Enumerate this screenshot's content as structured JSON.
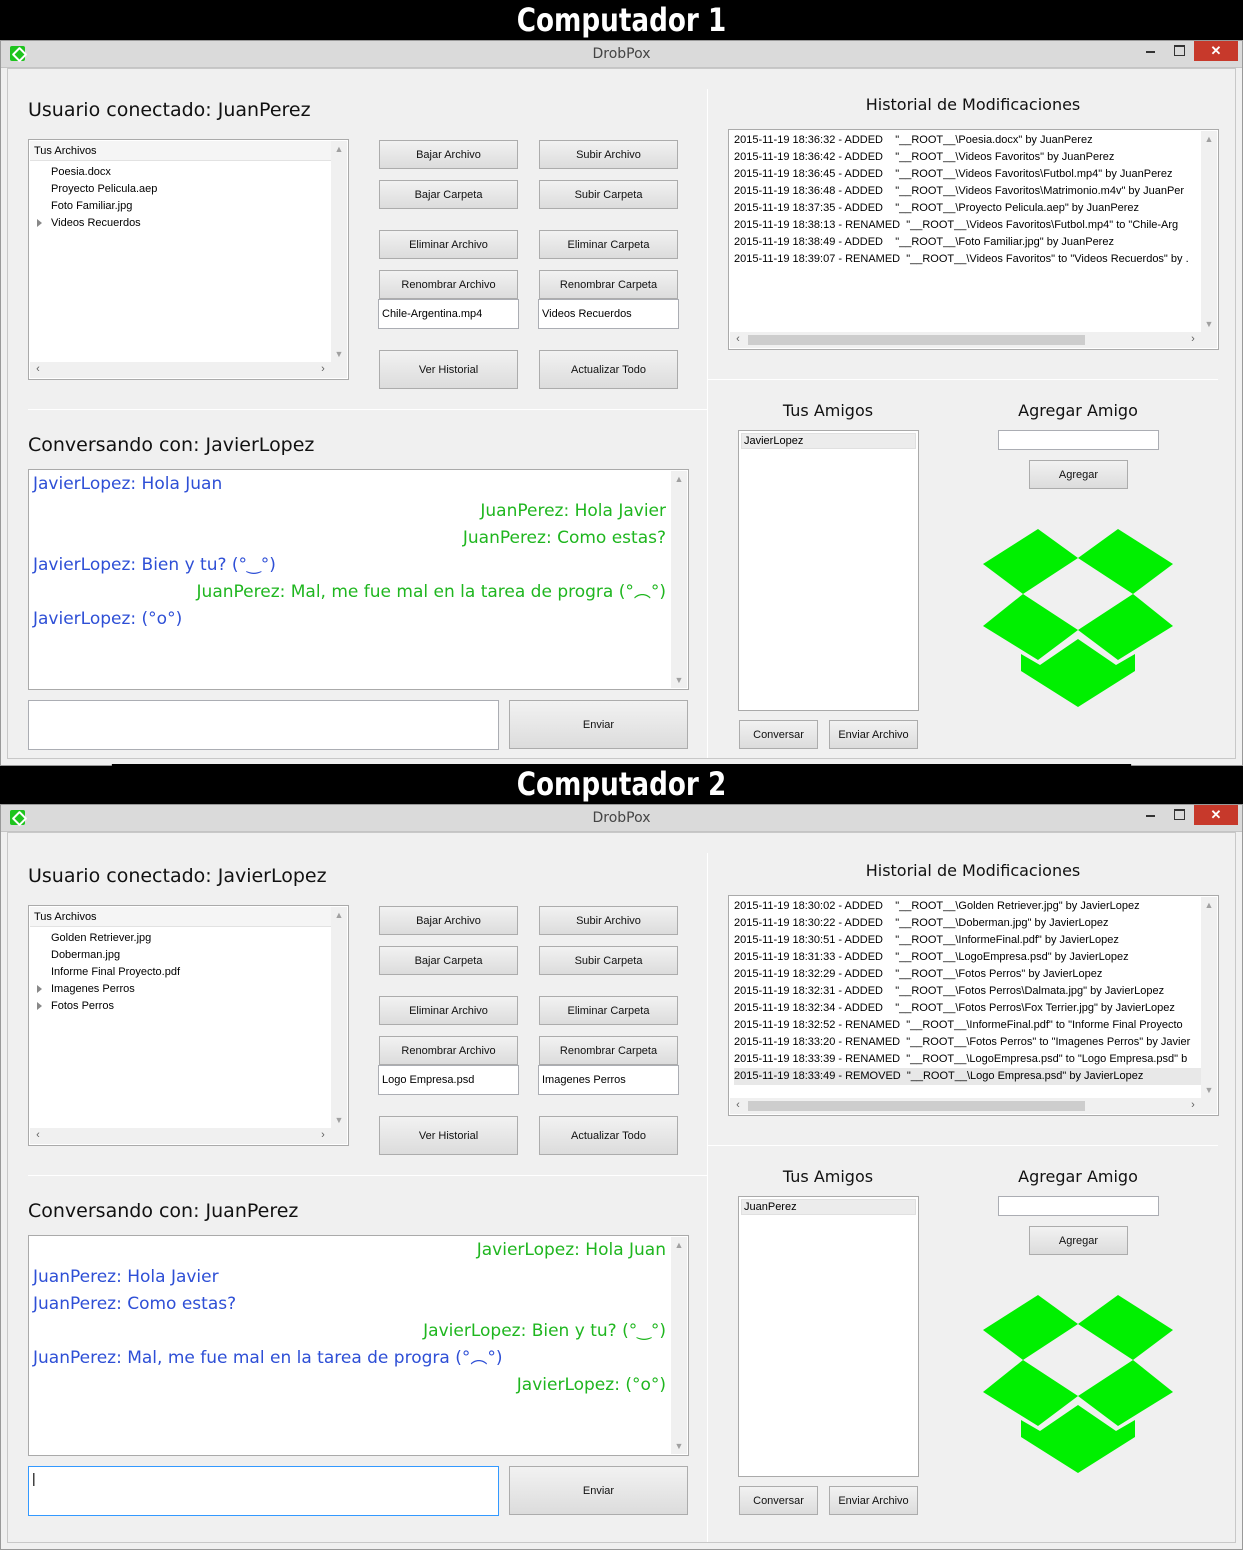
{
  "computers": [
    {
      "banner": "Computador 1",
      "window_title": "DrobPox",
      "user_label": "Usuario conectado: JuanPerez",
      "files_tree": {
        "header": "Tus Archivos",
        "items": [
          {
            "label": "Poesia.docx",
            "expandable": false
          },
          {
            "label": "Proyecto Pelicula.aep",
            "expandable": false
          },
          {
            "label": "Foto Familiar.jpg",
            "expandable": false
          },
          {
            "label": "Videos Recuerdos",
            "expandable": true
          }
        ]
      },
      "buttons": {
        "download_file": "Bajar Archivo",
        "upload_file": "Subir Archivo",
        "download_folder": "Bajar Carpeta",
        "upload_folder": "Subir Carpeta",
        "delete_file": "Eliminar Archivo",
        "delete_folder": "Eliminar Carpeta",
        "rename_file": "Renombrar Archivo",
        "rename_folder": "Renombrar Carpeta",
        "view_history": "Ver Historial",
        "refresh_all": "Actualizar Todo",
        "send": "Enviar",
        "add": "Agregar",
        "chat": "Conversar",
        "send_file": "Enviar Archivo"
      },
      "rename_file_value": "Chile-Argentina.mp4",
      "rename_folder_value": "Videos Recuerdos",
      "history_title": "Historial de Modificaciones",
      "history": [
        "2015-11-19 18:36:32 - ADDED    \"__ROOT__\\Poesia.docx\" by JuanPerez",
        "2015-11-19 18:36:42 - ADDED    \"__ROOT__\\Videos Favoritos\" by JuanPerez",
        "2015-11-19 18:36:45 - ADDED    \"__ROOT__\\Videos Favoritos\\Futbol.mp4\" by JuanPerez",
        "2015-11-19 18:36:48 - ADDED    \"__ROOT__\\Videos Favoritos\\Matrimonio.m4v\" by JuanPer",
        "2015-11-19 18:37:35 - ADDED    \"__ROOT__\\Proyecto Pelicula.aep\" by JuanPerez",
        "2015-11-19 18:38:13 - RENAMED  \"__ROOT__\\Videos Favoritos\\Futbol.mp4\" to \"Chile-Arg",
        "2015-11-19 18:38:49 - ADDED    \"__ROOT__\\Foto Familiar.jpg\" by JuanPerez",
        "2015-11-19 18:39:07 - RENAMED  \"__ROOT__\\Videos Favoritos\" to \"Videos Recuerdos\" by ."
      ],
      "history_selected_index": -1,
      "chat_label": "Conversando con: JavierLopez",
      "messages": [
        {
          "side": "left",
          "text": "JavierLopez: Hola Juan"
        },
        {
          "side": "right",
          "text": "JuanPerez: Hola Javier"
        },
        {
          "side": "right",
          "text": "JuanPerez: Como estas?"
        },
        {
          "side": "left",
          "text": "JavierLopez: Bien y tu? (°‿°)"
        },
        {
          "side": "right",
          "text": "JuanPerez: Mal, me fue mal en la tarea de progra (°︵°)"
        },
        {
          "side": "left",
          "text": "JavierLopez: (°o°)"
        }
      ],
      "message_input": "",
      "friends_title": "Tus Amigos",
      "friends": [
        "JavierLopez"
      ],
      "add_friend_title": "Agregar Amigo",
      "add_friend_input": ""
    },
    {
      "banner": "Computador 2",
      "window_title": "DrobPox",
      "user_label": "Usuario conectado: JavierLopez",
      "files_tree": {
        "header": "Tus Archivos",
        "items": [
          {
            "label": "Golden Retriever.jpg",
            "expandable": false
          },
          {
            "label": "Doberman.jpg",
            "expandable": false
          },
          {
            "label": "Informe Final Proyecto.pdf",
            "expandable": false
          },
          {
            "label": "Imagenes Perros",
            "expandable": true
          },
          {
            "label": "Fotos Perros",
            "expandable": true
          }
        ]
      },
      "buttons": {
        "download_file": "Bajar Archivo",
        "upload_file": "Subir Archivo",
        "download_folder": "Bajar Carpeta",
        "upload_folder": "Subir Carpeta",
        "delete_file": "Eliminar Archivo",
        "delete_folder": "Eliminar Carpeta",
        "rename_file": "Renombrar Archivo",
        "rename_folder": "Renombrar Carpeta",
        "view_history": "Ver Historial",
        "refresh_all": "Actualizar Todo",
        "send": "Enviar",
        "add": "Agregar",
        "chat": "Conversar",
        "send_file": "Enviar Archivo"
      },
      "rename_file_value": "Logo Empresa.psd",
      "rename_folder_value": "Imagenes Perros",
      "history_title": "Historial de Modificaciones",
      "history": [
        "2015-11-19 18:30:02 - ADDED    \"__ROOT__\\Golden Retriever.jpg\" by JavierLopez",
        "2015-11-19 18:30:22 - ADDED    \"__ROOT__\\Doberman.jpg\" by JavierLopez",
        "2015-11-19 18:30:51 - ADDED    \"__ROOT__\\InformeFinal.pdf\" by JavierLopez",
        "2015-11-19 18:31:33 - ADDED    \"__ROOT__\\LogoEmpresa.psd\" by JavierLopez",
        "2015-11-19 18:32:29 - ADDED    \"__ROOT__\\Fotos Perros\" by JavierLopez",
        "2015-11-19 18:32:31 - ADDED    \"__ROOT__\\Fotos Perros\\Dalmata.jpg\" by JavierLopez",
        "2015-11-19 18:32:34 - ADDED    \"__ROOT__\\Fotos Perros\\Fox Terrier.jpg\" by JavierLopez",
        "2015-11-19 18:32:52 - RENAMED  \"__ROOT__\\InformeFinal.pdf\" to \"Informe Final Proyecto",
        "2015-11-19 18:33:20 - RENAMED  \"__ROOT__\\Fotos Perros\" to \"Imagenes Perros\" by Javier",
        "2015-11-19 18:33:39 - RENAMED  \"__ROOT__\\LogoEmpresa.psd\" to \"Logo Empresa.psd\" b",
        "2015-11-19 18:33:49 - REMOVED  \"__ROOT__\\Logo Empresa.psd\" by JavierLopez"
      ],
      "history_selected_index": 10,
      "chat_label": "Conversando con: JuanPerez",
      "messages": [
        {
          "side": "right",
          "text": "JavierLopez: Hola Juan"
        },
        {
          "side": "left",
          "text": "JuanPerez: Hola Javier"
        },
        {
          "side": "left",
          "text": "JuanPerez: Como estas?"
        },
        {
          "side": "right",
          "text": "JavierLopez: Bien y tu? (°‿°)"
        },
        {
          "side": "left",
          "text": "JuanPerez: Mal, me fue mal en la tarea de progra (°︵°)"
        },
        {
          "side": "right",
          "text": "JavierLopez: (°o°)"
        }
      ],
      "message_input": "|",
      "friends_title": "Tus Amigos",
      "friends": [
        "JuanPerez"
      ],
      "add_friend_title": "Agregar Amigo",
      "add_friend_input": ""
    }
  ],
  "colors": {
    "logo_green": "#00f000",
    "message_blue": "#2e4fd6",
    "message_green": "#1fb61f",
    "close_red": "#c7392b"
  },
  "icons": {
    "app": "dropbox-icon",
    "logo": "dropbox-logo",
    "minimize": "minimize-icon",
    "maximize": "maximize-icon",
    "close": "close-icon"
  }
}
